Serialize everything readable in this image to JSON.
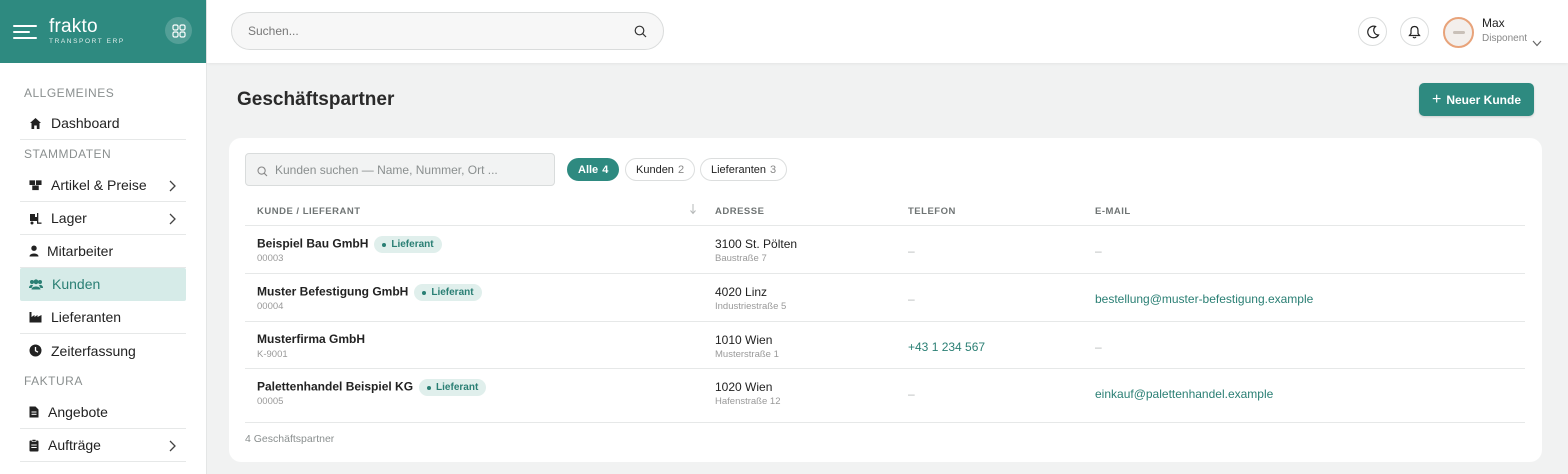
{
  "brand": {
    "name": "frakto",
    "subtitle": "TRANSPORT ERP"
  },
  "topbar": {
    "search_placeholder": "Suchen...",
    "user_name": "Max",
    "user_role": "Disponent"
  },
  "sidebar": {
    "sections": [
      {
        "title": "ALLGEMEINES"
      },
      {
        "title": "STAMMDATEN"
      },
      {
        "title": "FAKTURA"
      }
    ],
    "items": [
      {
        "label": "Dashboard",
        "icon": "home-icon",
        "has_submenu": false,
        "active": false
      },
      {
        "label": "Artikel & Preise",
        "icon": "boxes-icon",
        "has_submenu": true,
        "active": false
      },
      {
        "label": "Lager",
        "icon": "forklift-icon",
        "has_submenu": true,
        "active": false
      },
      {
        "label": "Mitarbeiter",
        "icon": "user-icon",
        "has_submenu": false,
        "active": false
      },
      {
        "label": "Kunden",
        "icon": "users-icon",
        "has_submenu": false,
        "active": true
      },
      {
        "label": "Lieferanten",
        "icon": "factory-icon",
        "has_submenu": false,
        "active": false
      },
      {
        "label": "Zeiterfassung",
        "icon": "clock-icon",
        "has_submenu": false,
        "active": false
      },
      {
        "label": "Angebote",
        "icon": "document-icon",
        "has_submenu": false,
        "active": false
      },
      {
        "label": "Aufträge",
        "icon": "clipboard-icon",
        "has_submenu": true,
        "active": false
      }
    ]
  },
  "page": {
    "title": "Geschäftspartner",
    "new_button": "Neuer Kunde",
    "filter_placeholder": "Kunden suchen — Name, Nummer, Ort ...",
    "filters": [
      {
        "label": "Alle",
        "count": "4",
        "active": true
      },
      {
        "label": "Kunden",
        "count": "2",
        "active": false
      },
      {
        "label": "Lieferanten",
        "count": "3",
        "active": false
      }
    ],
    "columns": [
      "KUNDE / LIEFERANT",
      "ADRESSE",
      "TELEFON",
      "E-MAIL"
    ],
    "rows": [
      {
        "name": "Beispiel Bau GmbH",
        "badge": "Lieferant",
        "number": "00003",
        "city": "3100 St. Pölten",
        "street": "Baustraße 7",
        "phone": "–",
        "email": "–"
      },
      {
        "name": "Muster Befestigung GmbH",
        "badge": "Lieferant",
        "number": "00004",
        "city": "4020 Linz",
        "street": "Industriestraße 5",
        "phone": "–",
        "email": "bestellung@muster-befestigung.example"
      },
      {
        "name": "Musterfirma GmbH",
        "badge": "",
        "number": "K-9001",
        "city": "1010 Wien",
        "street": "Musterstraße 1",
        "phone": "+43 1 234 567",
        "email": "–"
      },
      {
        "name": "Palettenhandel Beispiel KG",
        "badge": "Lieferant",
        "number": "00005",
        "city": "1020 Wien",
        "street": "Hafenstraße 12",
        "phone": "–",
        "email": "einkauf@palettenhandel.example"
      }
    ],
    "footer_count": "4 Geschäftspartner"
  }
}
